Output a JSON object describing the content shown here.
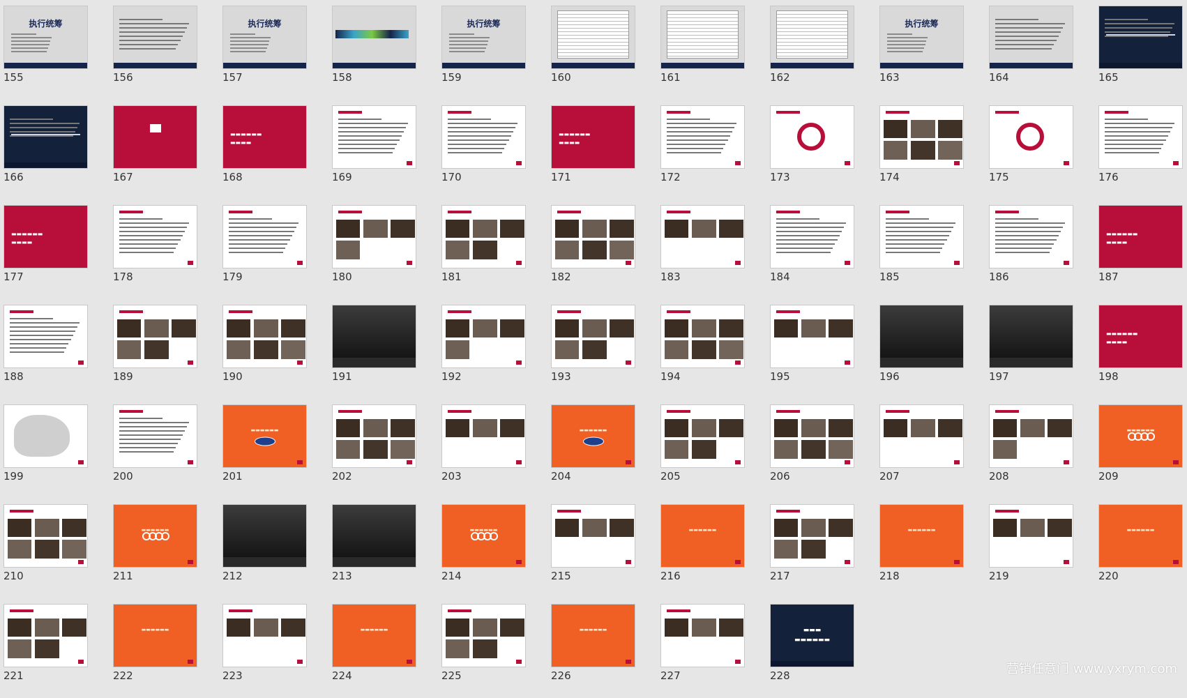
{
  "slides": [
    {
      "n": "155",
      "kind": "gray-title",
      "title": "执行统筹"
    },
    {
      "n": "156",
      "kind": "gray-text"
    },
    {
      "n": "157",
      "kind": "gray-title",
      "title": "执行统筹"
    },
    {
      "n": "158",
      "kind": "gray-bar"
    },
    {
      "n": "159",
      "kind": "gray-title",
      "title": "执行统筹"
    },
    {
      "n": "160",
      "kind": "gray-table"
    },
    {
      "n": "161",
      "kind": "gray-table"
    },
    {
      "n": "162",
      "kind": "gray-table"
    },
    {
      "n": "163",
      "kind": "gray-title",
      "title": "执行统筹"
    },
    {
      "n": "164",
      "kind": "gray-text"
    },
    {
      "n": "165",
      "kind": "navy-text"
    },
    {
      "n": "166",
      "kind": "navy-text"
    },
    {
      "n": "167",
      "kind": "red-logo"
    },
    {
      "n": "168",
      "kind": "red-text"
    },
    {
      "n": "169",
      "kind": "white-text"
    },
    {
      "n": "170",
      "kind": "white-text"
    },
    {
      "n": "171",
      "kind": "red-text"
    },
    {
      "n": "172",
      "kind": "white-text"
    },
    {
      "n": "173",
      "kind": "white-diagram"
    },
    {
      "n": "174",
      "kind": "white-photos"
    },
    {
      "n": "175",
      "kind": "white-diagram"
    },
    {
      "n": "176",
      "kind": "white-text"
    },
    {
      "n": "177",
      "kind": "red-text"
    },
    {
      "n": "178",
      "kind": "white-text"
    },
    {
      "n": "179",
      "kind": "white-text"
    },
    {
      "n": "180",
      "kind": "white-photos"
    },
    {
      "n": "181",
      "kind": "white-photos"
    },
    {
      "n": "182",
      "kind": "white-photos"
    },
    {
      "n": "183",
      "kind": "white-photos"
    },
    {
      "n": "184",
      "kind": "white-text"
    },
    {
      "n": "185",
      "kind": "white-text"
    },
    {
      "n": "186",
      "kind": "white-text"
    },
    {
      "n": "187",
      "kind": "red-text"
    },
    {
      "n": "188",
      "kind": "white-text"
    },
    {
      "n": "189",
      "kind": "white-photos"
    },
    {
      "n": "190",
      "kind": "white-photos"
    },
    {
      "n": "191",
      "kind": "dark-photo"
    },
    {
      "n": "192",
      "kind": "white-photos"
    },
    {
      "n": "193",
      "kind": "white-photos"
    },
    {
      "n": "194",
      "kind": "white-photos"
    },
    {
      "n": "195",
      "kind": "white-photos"
    },
    {
      "n": "196",
      "kind": "dark-photo"
    },
    {
      "n": "197",
      "kind": "dark-photo"
    },
    {
      "n": "198",
      "kind": "red-text"
    },
    {
      "n": "199",
      "kind": "white-map"
    },
    {
      "n": "200",
      "kind": "white-text"
    },
    {
      "n": "201",
      "kind": "orange-ford"
    },
    {
      "n": "202",
      "kind": "white-photos"
    },
    {
      "n": "203",
      "kind": "white-photos"
    },
    {
      "n": "204",
      "kind": "orange-ford"
    },
    {
      "n": "205",
      "kind": "white-photos"
    },
    {
      "n": "206",
      "kind": "white-photos"
    },
    {
      "n": "207",
      "kind": "white-photos"
    },
    {
      "n": "208",
      "kind": "white-photos"
    },
    {
      "n": "209",
      "kind": "orange-audi"
    },
    {
      "n": "210",
      "kind": "white-photos"
    },
    {
      "n": "211",
      "kind": "orange-audi"
    },
    {
      "n": "212",
      "kind": "dark-photo"
    },
    {
      "n": "213",
      "kind": "dark-photo"
    },
    {
      "n": "214",
      "kind": "orange-audi"
    },
    {
      "n": "215",
      "kind": "white-photos"
    },
    {
      "n": "216",
      "kind": "orange-text"
    },
    {
      "n": "217",
      "kind": "white-photos"
    },
    {
      "n": "218",
      "kind": "orange-text"
    },
    {
      "n": "219",
      "kind": "white-photos"
    },
    {
      "n": "220",
      "kind": "orange-text"
    },
    {
      "n": "221",
      "kind": "white-photos"
    },
    {
      "n": "222",
      "kind": "orange-text"
    },
    {
      "n": "223",
      "kind": "white-photos"
    },
    {
      "n": "224",
      "kind": "orange-text"
    },
    {
      "n": "225",
      "kind": "white-photos"
    },
    {
      "n": "226",
      "kind": "orange-text"
    },
    {
      "n": "227",
      "kind": "white-photos"
    },
    {
      "n": "228",
      "kind": "navy-thanks"
    }
  ],
  "colors": {
    "background": "#e6e6e6",
    "navy": "#13213b",
    "crimson": "#b80f3a",
    "orange": "#f06024",
    "gray_slide": "#d9d9d9"
  },
  "watermark": "营销任意门 www.yxrym.com"
}
